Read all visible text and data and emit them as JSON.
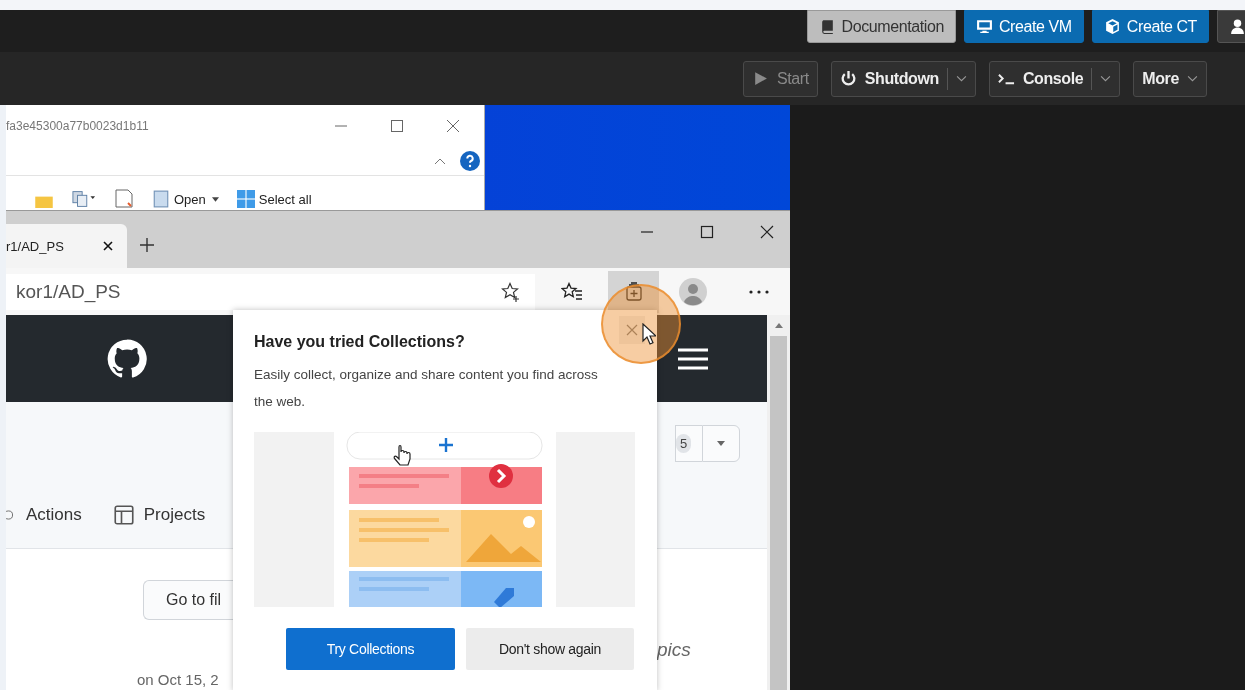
{
  "header": {
    "buttons": [
      {
        "label": "Documentation",
        "kind": "secondary"
      },
      {
        "label": "Create VM",
        "kind": "primary"
      },
      {
        "label": "Create CT",
        "kind": "primary"
      }
    ]
  },
  "toolbar": {
    "buttons": [
      {
        "label": "Start",
        "disabled": true,
        "kind": "plain"
      },
      {
        "label": "Shutdown",
        "disabled": false,
        "kind": "split"
      },
      {
        "label": "Console",
        "disabled": false,
        "kind": "split"
      },
      {
        "label": "More",
        "disabled": false,
        "kind": "menu"
      }
    ]
  },
  "explorer": {
    "title": "fa3e45300a77b0023d1b11",
    "ribbon": [
      {
        "label": "Open",
        "kind": "menu"
      },
      {
        "label": "Select all",
        "kind": "plain"
      }
    ]
  },
  "browser": {
    "tab": {
      "title": "r1/AD_PS"
    },
    "address": "kor1/AD_PS",
    "page": {
      "counter": "5",
      "nav": [
        "Actions",
        "Projects"
      ],
      "go_to_file": "Go to fil",
      "topics": "pics",
      "date": "on Oct 15, 2"
    },
    "popup": {
      "title": "Have you tried Collections?",
      "body": "Easily collect, organize and share content you find across the web.",
      "buttons": [
        {
          "label": "Try Collections",
          "kind": "primary"
        },
        {
          "label": "Don't show again",
          "kind": "secondary"
        }
      ]
    }
  }
}
